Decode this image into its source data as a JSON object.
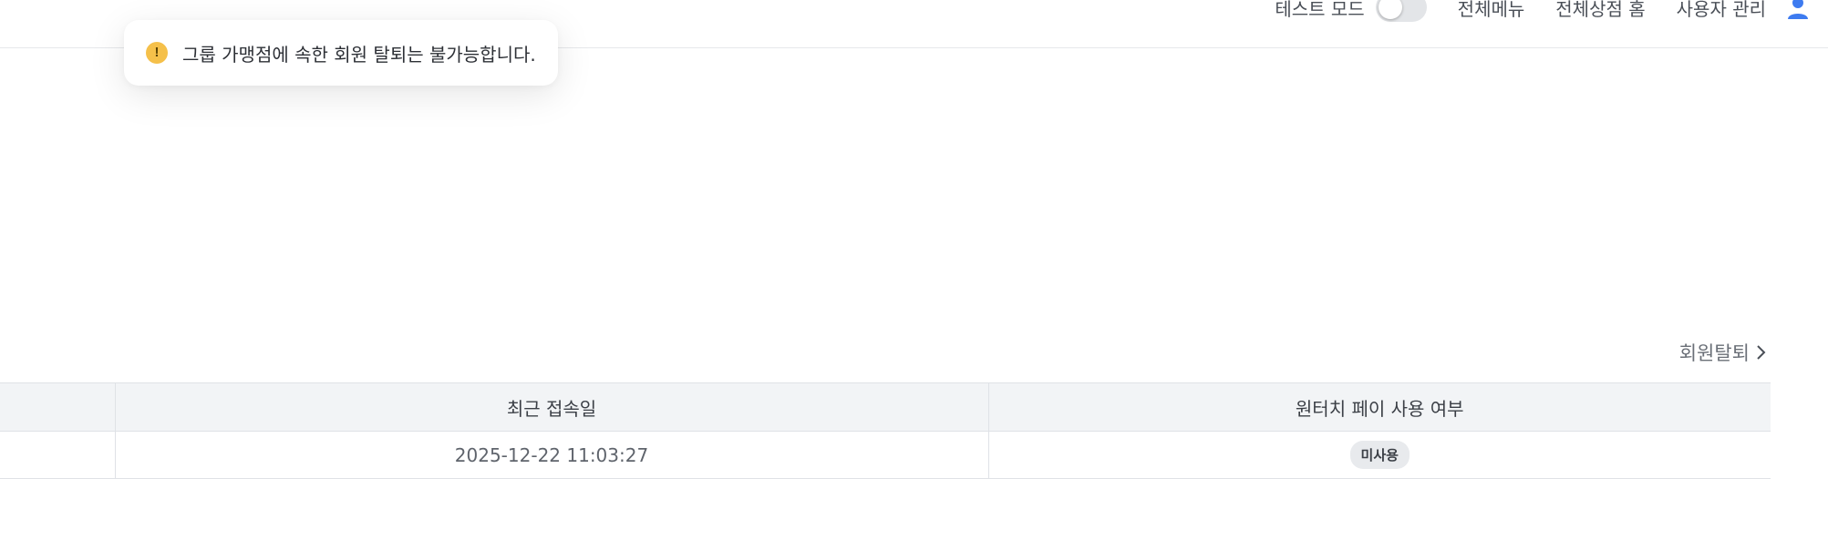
{
  "header": {
    "test_mode_label": "테스트 모드",
    "test_mode_on": false,
    "nav": [
      "전체메뉴",
      "전체상점 홈",
      "사용자 관리"
    ]
  },
  "toast": {
    "message": "그룹 가맹점에 속한 회원 탈퇴는 불가능합니다.",
    "icon": "warning-icon",
    "icon_color": "#f5c04a"
  },
  "actions": {
    "withdraw_label": "회원탈퇴"
  },
  "table": {
    "columns": [
      "",
      "최근 접속일",
      "원터치 페이 사용 여부"
    ],
    "rows": [
      {
        "cells": [
          "",
          "2025-12-22 11:03:27",
          "미사용"
        ]
      }
    ]
  },
  "colors": {
    "accent_user_icon": "#3d7bf0",
    "header_bg": "#f2f4f6"
  }
}
